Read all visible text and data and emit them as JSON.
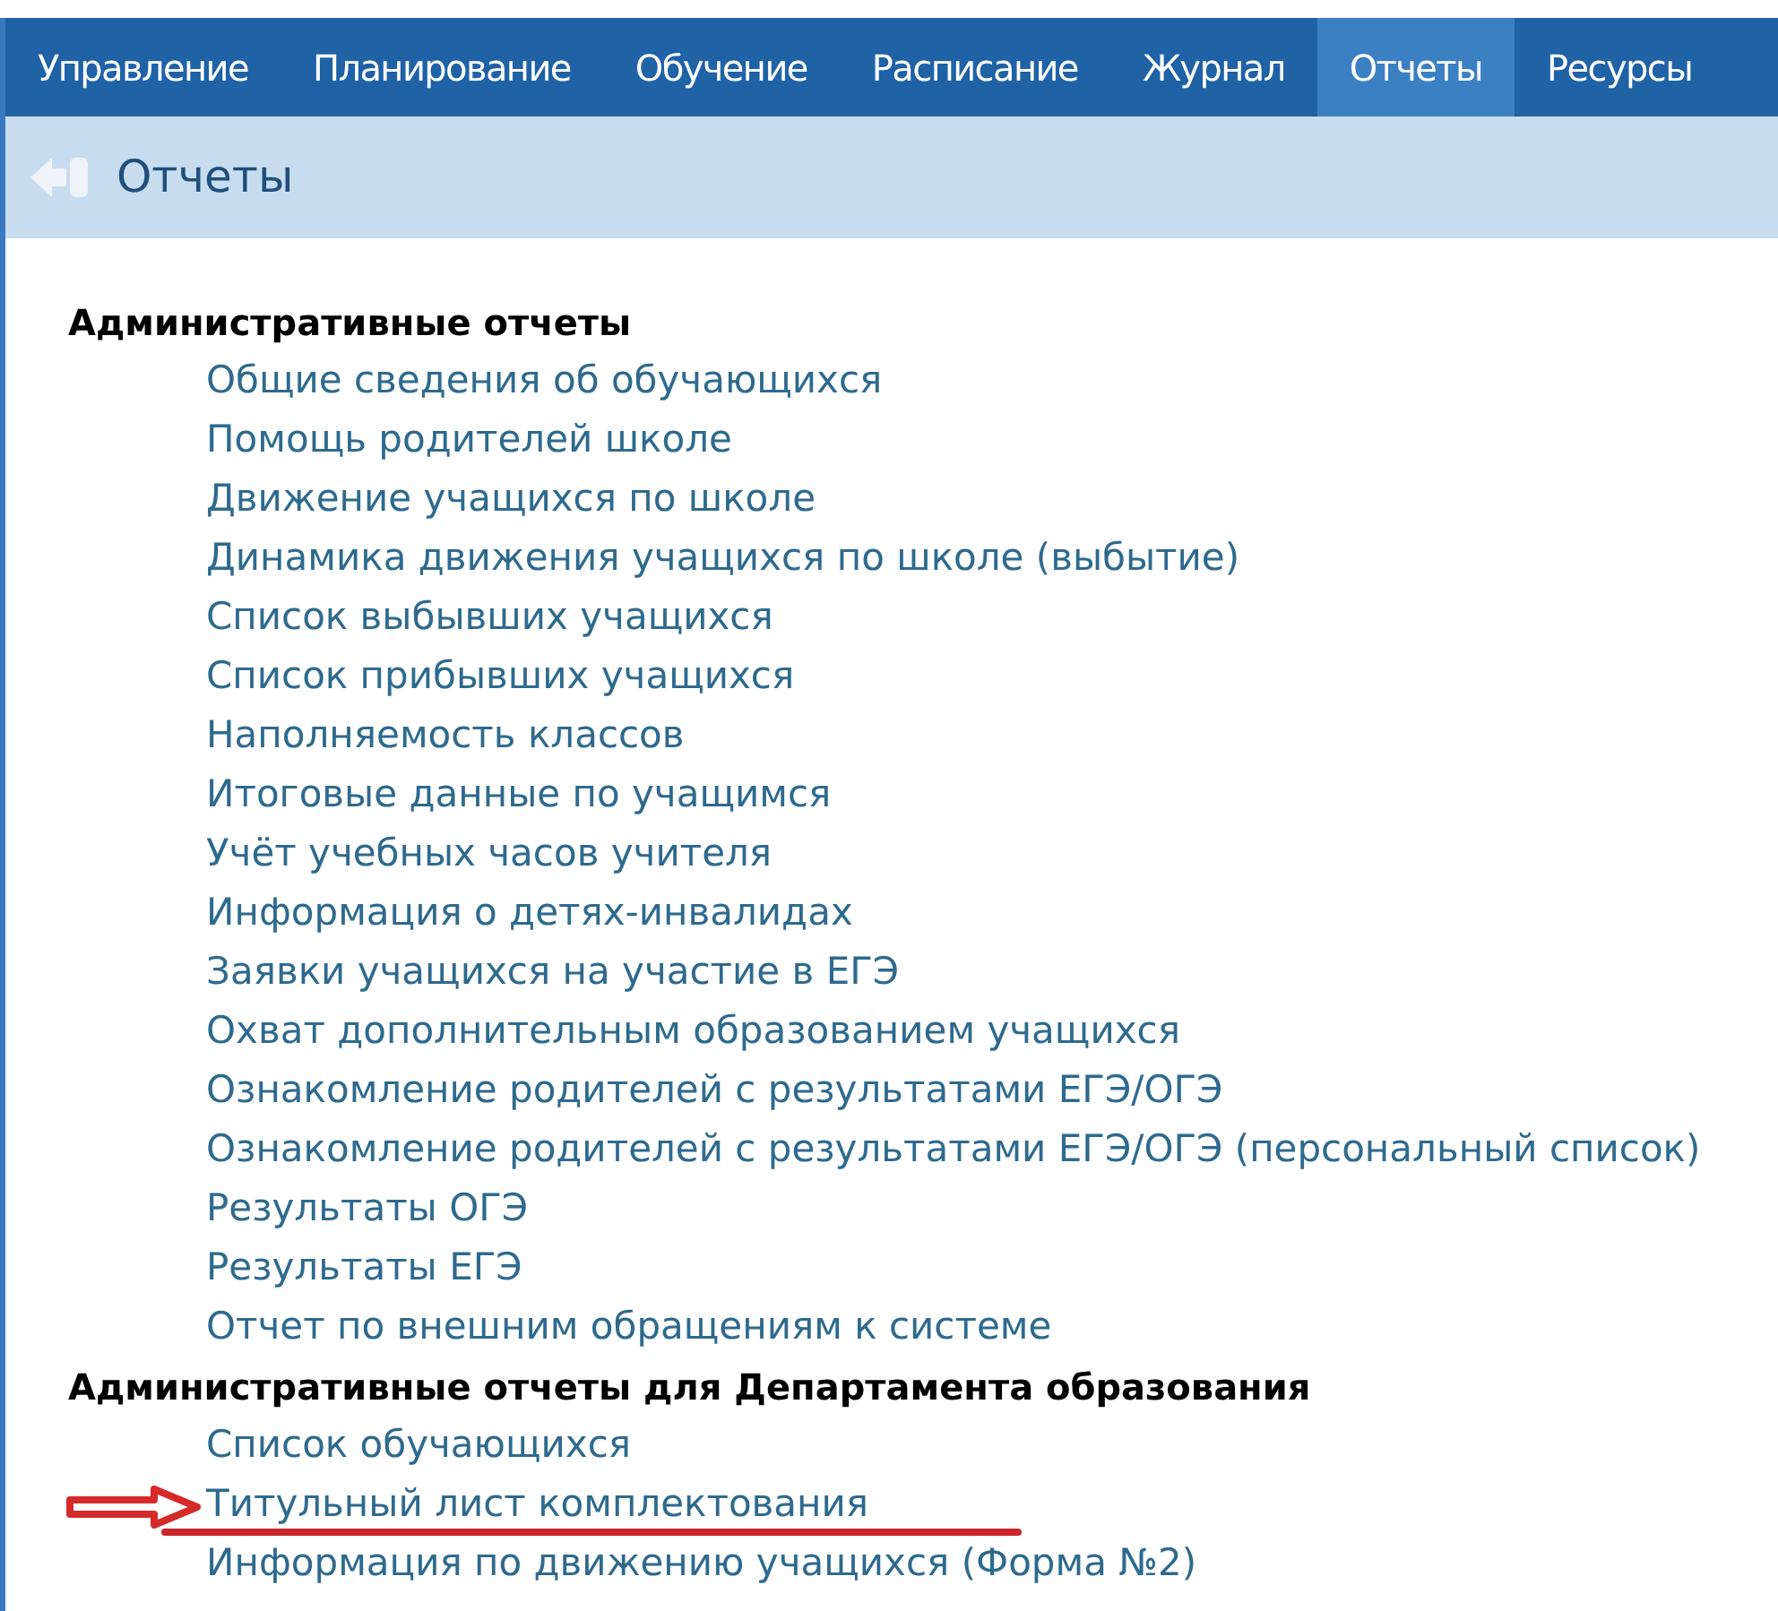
{
  "nav": [
    {
      "label": "Управление",
      "selected": false
    },
    {
      "label": "Планирование",
      "selected": false
    },
    {
      "label": "Обучение",
      "selected": false
    },
    {
      "label": "Расписание",
      "selected": false
    },
    {
      "label": "Журнал",
      "selected": false
    },
    {
      "label": "Отчеты",
      "selected": true
    },
    {
      "label": "Ресурсы",
      "selected": false
    }
  ],
  "page_title": "Отчеты",
  "sections": [
    {
      "title": "Административные отчеты",
      "items": [
        {
          "label": "Общие сведения об обучающихся",
          "annotated": false
        },
        {
          "label": "Помощь родителей школе",
          "annotated": false
        },
        {
          "label": "Движение учащихся по школе",
          "annotated": false
        },
        {
          "label": "Динамика движения учащихся по школе (выбытие)",
          "annotated": false
        },
        {
          "label": "Список выбывших учащихся",
          "annotated": false
        },
        {
          "label": "Список прибывших учащихся",
          "annotated": false
        },
        {
          "label": "Наполняемость классов",
          "annotated": false
        },
        {
          "label": "Итоговые данные по учащимся",
          "annotated": false
        },
        {
          "label": "Учёт учебных часов учителя",
          "annotated": false
        },
        {
          "label": "Информация о детях-инвалидах",
          "annotated": false
        },
        {
          "label": "Заявки учащихся на участие в ЕГЭ",
          "annotated": false
        },
        {
          "label": "Охват дополнительным образованием учащихся",
          "annotated": false
        },
        {
          "label": "Ознакомление родителей с результатами ЕГЭ/ОГЭ",
          "annotated": false
        },
        {
          "label": "Ознакомление родителей с результатами ЕГЭ/ОГЭ (персональный список)",
          "annotated": false
        },
        {
          "label": "Результаты ОГЭ",
          "annotated": false
        },
        {
          "label": "Результаты ЕГЭ",
          "annotated": false
        },
        {
          "label": "Отчет по внешним обращениям к системе",
          "annotated": false
        }
      ]
    },
    {
      "title": "Административные отчеты для Департамента образования",
      "items": [
        {
          "label": "Список обучающихся",
          "annotated": false
        },
        {
          "label": "Титульный лист комплектования",
          "annotated": true
        },
        {
          "label": "Информация по движению учащихся (Форма №2)",
          "annotated": false
        }
      ]
    }
  ]
}
